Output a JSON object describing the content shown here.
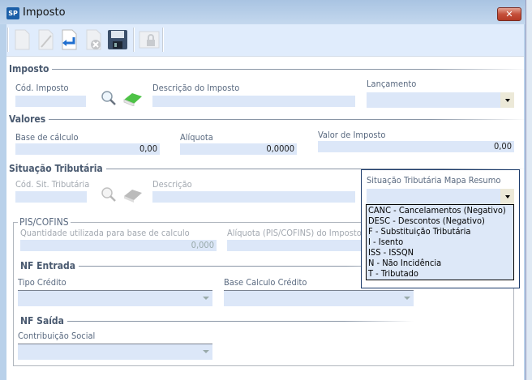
{
  "window": {
    "title": "Imposto",
    "icon_text": "SP",
    "close": "✕"
  },
  "toolbar": {
    "buttons": [
      "new-icon",
      "edit-icon",
      "undo-icon",
      "delete-icon",
      "save-icon",
      "lock-icon"
    ]
  },
  "imposto": {
    "section": "Imposto",
    "cod_label": "Cód. Imposto",
    "cod_value": "",
    "descricao_label": "Descrição do Imposto",
    "descricao_value": "",
    "lancamento_label": "Lançamento",
    "lancamento_value": ""
  },
  "valores": {
    "section": "Valores",
    "base_label": "Base de cálculo",
    "base_value": "0,00",
    "aliquota_label": "Alíquota",
    "aliquota_value": "0,0000",
    "valor_label": "Valor de Imposto",
    "valor_value": "0,00"
  },
  "situacao": {
    "section": "Situação Tributária",
    "cod_label": "Cód. Sit. Tributária",
    "descricao_label": "Descrição",
    "mapa_label": "Situação Tributária Mapa Resumo",
    "mapa_value": "",
    "options": [
      "CANC - Cancelamentos (Negativo)",
      "DESC - Descontos (Negativo)",
      "F - Substituição Tributária",
      "I - Isento",
      "ISS - ISSQN",
      "N - Não Incidência",
      "T - Tributado"
    ]
  },
  "pis": {
    "group": "PIS/COFINS",
    "qtd_label": "Quantidade utilizada para base de calculo",
    "qtd_value": "0,000",
    "aliq_label": "Alíquota (PIS/COFINS) do Imposto e",
    "nf_entrada": "NF Entrada",
    "tipo_credito_label": "Tipo Crédito",
    "base_credito_label": "Base Calculo Crédito",
    "nf_saida": "NF Saída",
    "contrib_label": "Contribuição Social"
  }
}
